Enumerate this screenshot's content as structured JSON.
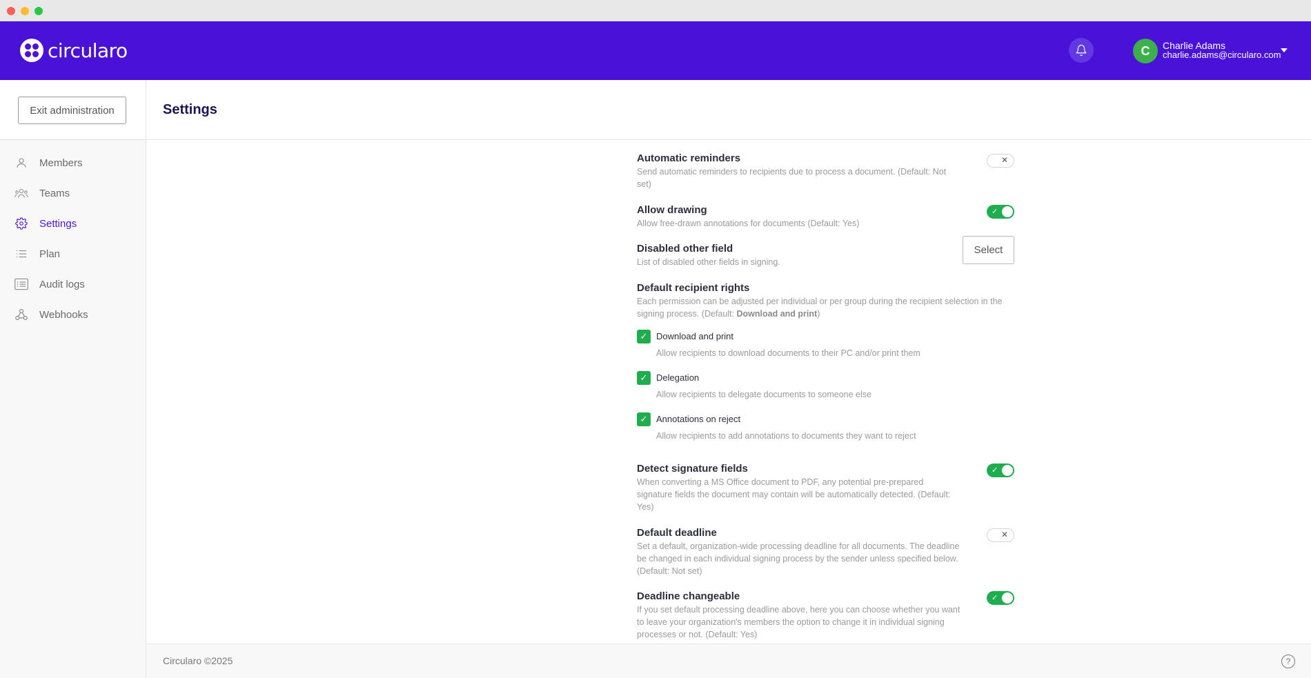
{
  "brand": {
    "name": "circularo",
    "accent": "#4a12d9",
    "success": "#1fad4f"
  },
  "user": {
    "initial": "C",
    "name": "Charlie Adams",
    "email": "charlie.adams@circularo.com"
  },
  "sidebar": {
    "exit_label": "Exit administration",
    "items": [
      {
        "label": "Members",
        "icon": "user-icon"
      },
      {
        "label": "Teams",
        "icon": "team-icon"
      },
      {
        "label": "Settings",
        "icon": "gear-icon",
        "active": true
      },
      {
        "label": "Plan",
        "icon": "list-icon"
      },
      {
        "label": "Audit logs",
        "icon": "audit-log-icon"
      },
      {
        "label": "Webhooks",
        "icon": "webhook-icon"
      }
    ]
  },
  "page": {
    "title": "Settings"
  },
  "settings": {
    "automatic_reminders": {
      "title": "Automatic reminders",
      "desc": "Send automatic reminders to recipients due to process a document.  (Default: Not set)",
      "enabled": false
    },
    "allow_drawing": {
      "title": "Allow drawing",
      "desc": "Allow free-drawn annotations for documents  (Default: Yes)",
      "enabled": true
    },
    "disabled_other_field": {
      "title": "Disabled other field",
      "desc": "List of disabled other fields in signing.",
      "button": "Select"
    },
    "default_recipient_rights": {
      "title": "Default recipient rights",
      "desc_prefix": "Each permission can be adjusted per individual or per group during the recipient selection in the signing process.  (Default: ",
      "desc_bold": "Download and print",
      "desc_suffix": ")",
      "options": [
        {
          "label": "Download and print",
          "desc": "Allow recipients to download documents to their PC and/or print them",
          "checked": true
        },
        {
          "label": "Delegation",
          "desc": "Allow recipients to delegate documents to someone else",
          "checked": true
        },
        {
          "label": "Annotations on reject",
          "desc": "Allow recipients to add annotations to documents they want to reject",
          "checked": true
        }
      ]
    },
    "detect_signature_fields": {
      "title": "Detect signature fields",
      "desc": "When converting a MS Office document to PDF, any potential pre-prepared signature fields the document may contain will be automatically detected.  (Default: Yes)",
      "enabled": true
    },
    "default_deadline": {
      "title": "Default deadline",
      "desc": "Set a default, organization-wide processing deadline for all documents. The deadline be changed in each individual signing process by the sender unless specified below.  (Default: Not set)",
      "enabled": false
    },
    "deadline_changeable": {
      "title": "Deadline changeable",
      "desc": "If you set default processing deadline above, here you can choose whether you want to leave your organization's members the option to change it in individual signing processes or not.  (Default: Yes)",
      "enabled": true
    }
  },
  "footer": {
    "text": "Circularo ©2025",
    "help": "?"
  }
}
